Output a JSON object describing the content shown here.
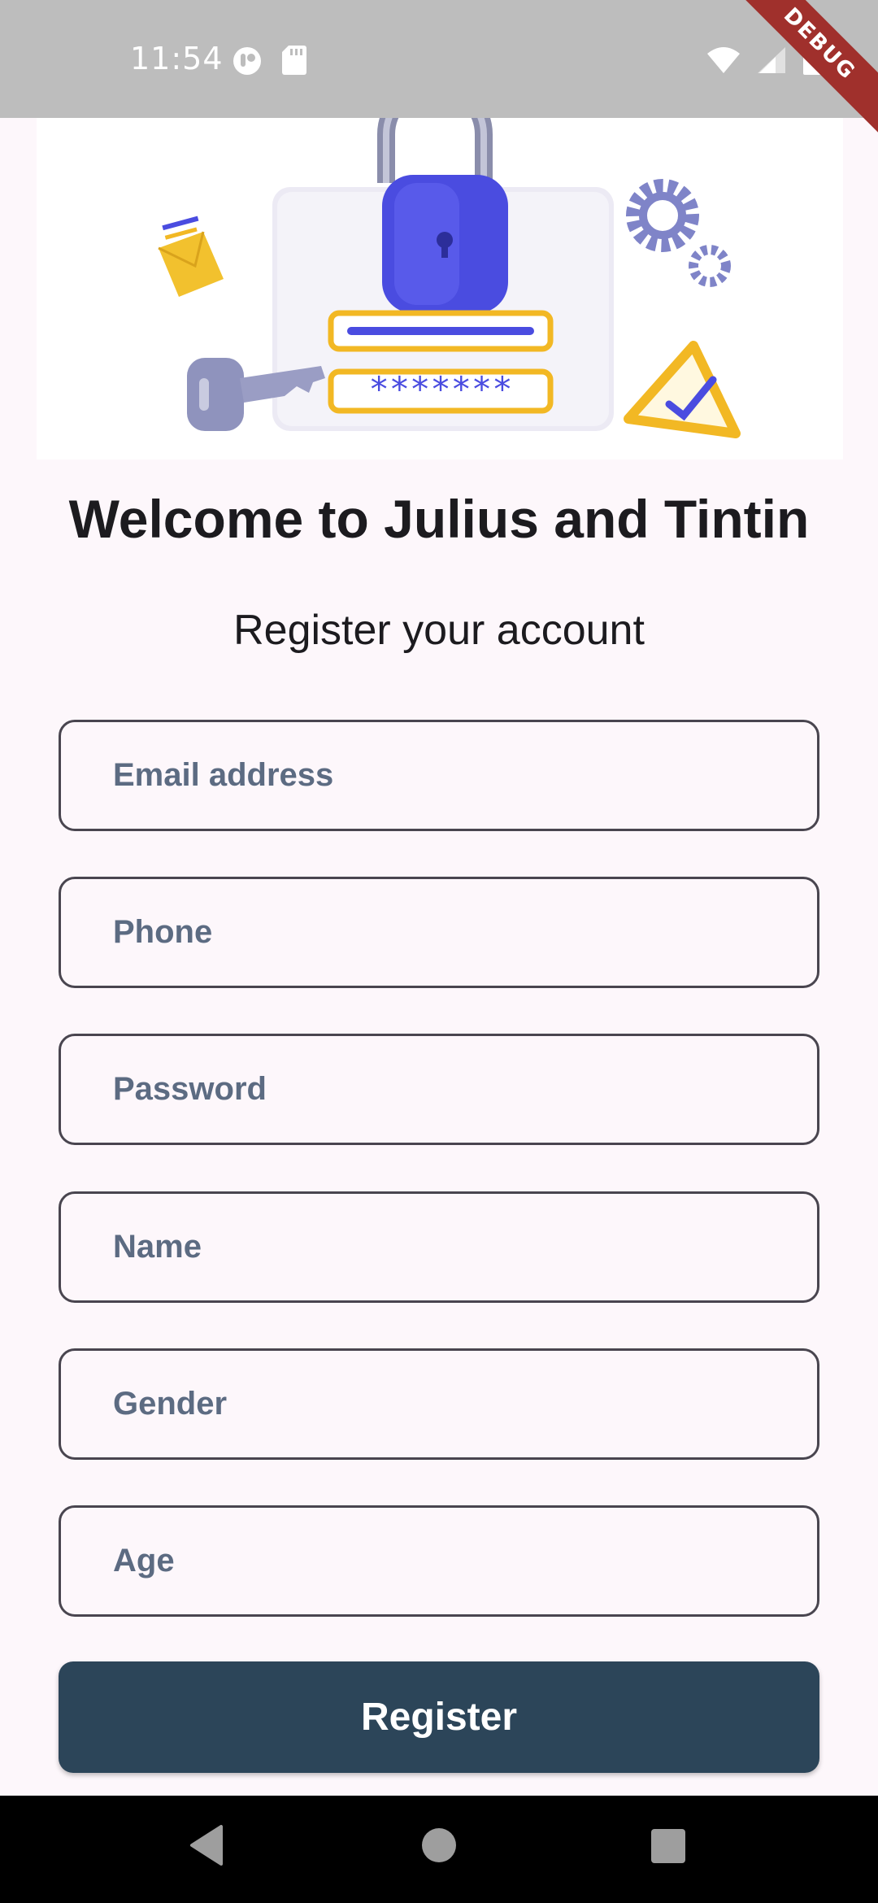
{
  "status_bar": {
    "time": "11:54",
    "left_icons": [
      "record-icon",
      "sd-card-icon"
    ],
    "right_icons": [
      "wifi-icon",
      "signal-icon",
      "battery-icon"
    ],
    "debug_label": "DEBUG"
  },
  "hero": {
    "illustration": "lock-password-illustration",
    "password_mask": "*******"
  },
  "titles": {
    "welcome": "Welcome to Julius and Tintin",
    "subtitle": "Register your account"
  },
  "form": {
    "email": {
      "placeholder": "Email address",
      "value": ""
    },
    "phone": {
      "placeholder": "Phone",
      "value": ""
    },
    "password": {
      "placeholder": "Password",
      "value": ""
    },
    "name": {
      "placeholder": "Name",
      "value": ""
    },
    "gender": {
      "placeholder": "Gender",
      "value": ""
    },
    "age": {
      "placeholder": "Age",
      "value": ""
    },
    "submit_label": "Register"
  },
  "colors": {
    "background": "#fdf7fb",
    "button": "#2c4559",
    "placeholder": "#5c6b82",
    "debug_banner": "#a0302c"
  },
  "nav_bar": {
    "buttons": [
      "back-icon",
      "home-icon",
      "recents-icon"
    ]
  }
}
